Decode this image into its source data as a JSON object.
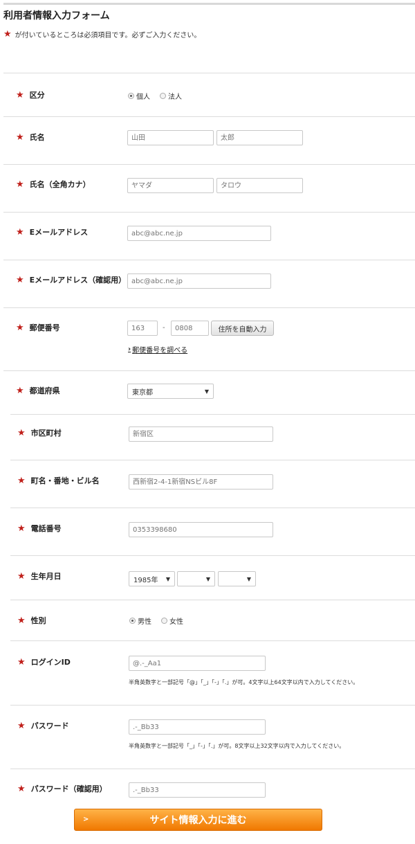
{
  "page": {
    "title": "利用者情報入力フォーム",
    "required_note": "が付いているところは必須項目です。必ずご入力ください。"
  },
  "fields": {
    "kubun": {
      "label": "区分",
      "options": [
        "個人",
        "法人"
      ],
      "selected": "個人"
    },
    "name": {
      "label": "氏名",
      "last_placeholder": "山田",
      "first_placeholder": "太郎"
    },
    "kana": {
      "label": "氏名（全角カナ）",
      "last_placeholder": "ヤマダ",
      "first_placeholder": "タロウ"
    },
    "email": {
      "label": "Eメールアドレス",
      "placeholder": "abc@abc.ne.jp"
    },
    "email_confirm": {
      "label": "Eメールアドレス（確認用）",
      "placeholder": "abc@abc.ne.jp"
    },
    "zip": {
      "label": "郵便番号",
      "first_placeholder": "163",
      "separator": "-",
      "second_placeholder": "0808",
      "autofill_button": "住所を自動入力",
      "lookup_link": "郵便番号を調べる"
    },
    "prefecture": {
      "label": "都道府県",
      "selected": "東京都"
    },
    "city": {
      "label": "市区町村",
      "placeholder": "新宿区"
    },
    "street": {
      "label": "町名・番地・ビル名",
      "placeholder": "西新宿2-4-1新宿NSビル8F"
    },
    "phone": {
      "label": "電話番号",
      "placeholder": "0353398680"
    },
    "birthday": {
      "label": "生年月日",
      "year": "1985年",
      "month": "",
      "day": ""
    },
    "gender": {
      "label": "性別",
      "options": [
        "男性",
        "女性"
      ],
      "selected": "男性"
    },
    "login_id": {
      "label": "ログインID",
      "placeholder": "@.-_Aa1",
      "hint": "半角英数字と一部記号「@」「_」「-」「.」が可。4文字以上64文字以内で入力してください。"
    },
    "password": {
      "label": "パスワード",
      "placeholder": ".-_Bb33",
      "hint": "半角英数字と一部記号「_」「-」「.」が可。8文字以上32文字以内で入力してください。"
    },
    "password_confirm": {
      "label": "パスワード（確認用）",
      "placeholder": ".-_Bb33"
    }
  },
  "submit_label": "サイト情報入力に進む",
  "icons": {
    "required": "red-star-icon",
    "dropdown": "triangle-down-icon",
    "link": "chevron-right-icon"
  },
  "colors": {
    "required_star": "#c0201b",
    "submit_top": "#ffb347",
    "submit_bottom": "#f07800"
  }
}
